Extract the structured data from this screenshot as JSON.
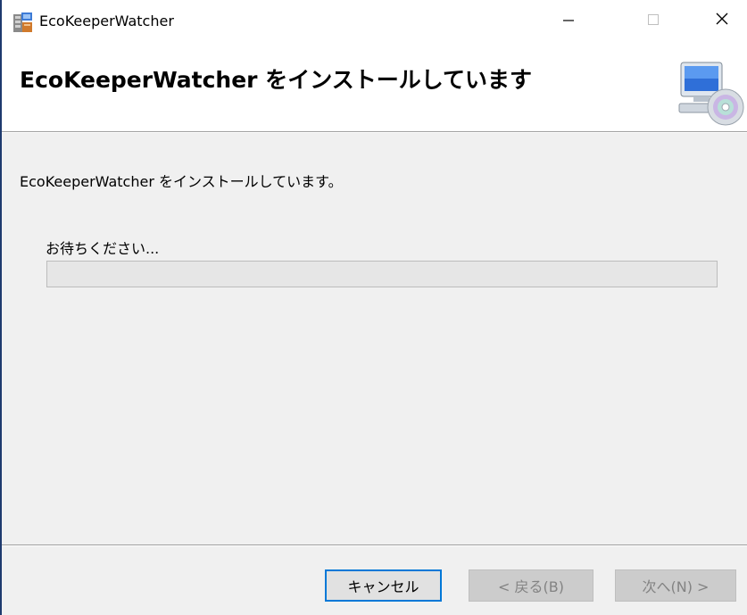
{
  "window": {
    "title": "EcoKeeperWatcher",
    "min_glyph": "—",
    "max_glyph": "☐",
    "close_glyph": "✕"
  },
  "header": {
    "title": "EcoKeeperWatcher をインストールしています"
  },
  "main": {
    "status_text": "EcoKeeperWatcher をインストールしています。",
    "wait_text": "お待ちください...",
    "progress_fraction": 0
  },
  "footer": {
    "cancel_label": "キャンセル",
    "back_label": "< 戻る(B)",
    "next_label": "次へ(N) >"
  },
  "icons": {
    "app": "installer-package-icon",
    "header": "computer-cd-icon"
  },
  "colors": {
    "focus_border": "#0078d7",
    "disabled_text": "#838383"
  }
}
